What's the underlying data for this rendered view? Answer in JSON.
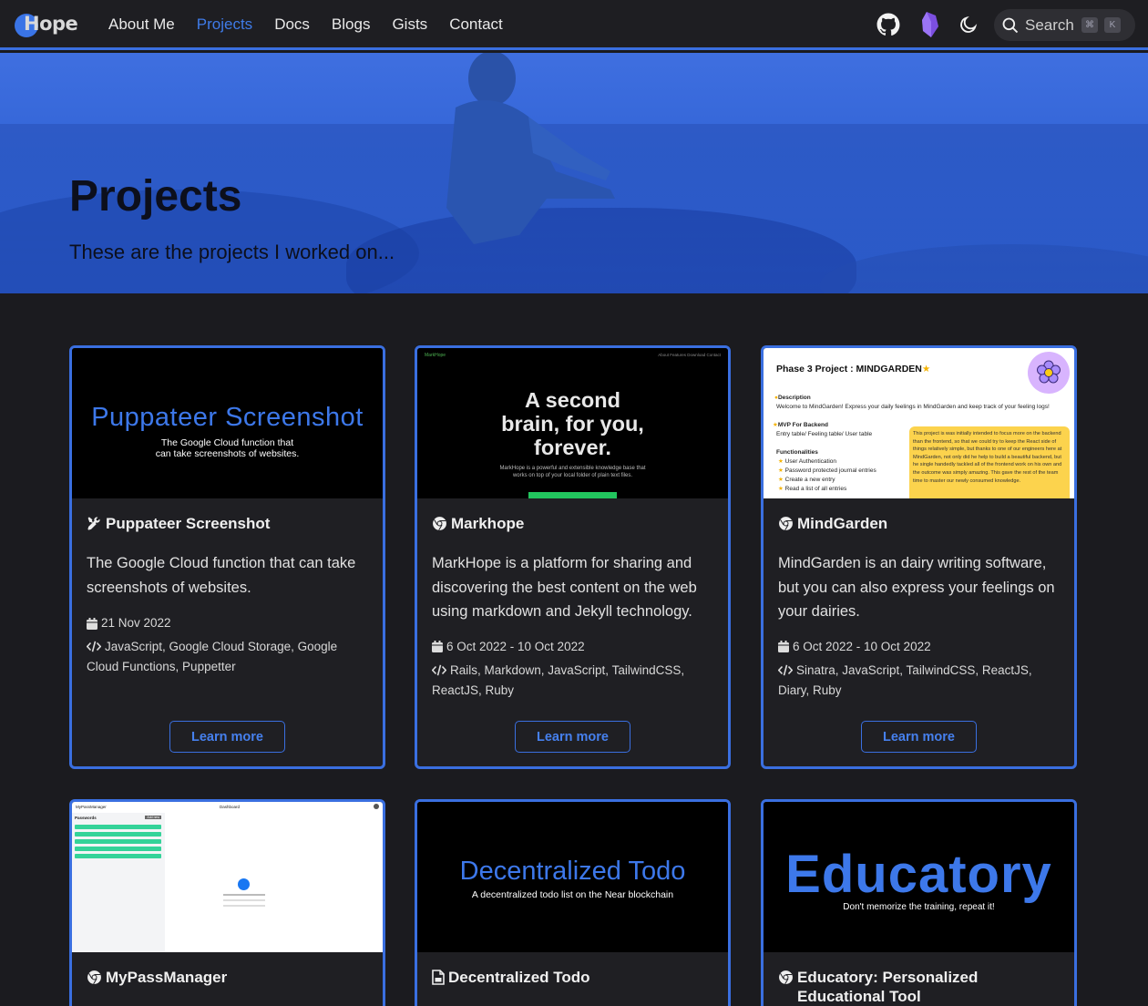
{
  "brand": {
    "name": "Hope"
  },
  "nav": {
    "items": [
      "About Me",
      "Projects",
      "Docs",
      "Blogs",
      "Gists",
      "Contact"
    ],
    "active": "Projects"
  },
  "toolbar": {
    "github_icon": "github-icon",
    "obsidian_icon": "obsidian-icon",
    "theme_icon": "moon-icon"
  },
  "search": {
    "placeholder": "Search",
    "key1": "⌘",
    "key2": "K"
  },
  "hero": {
    "title": "Projects",
    "subtitle": "These are the projects I worked on..."
  },
  "cards": [
    {
      "icon": "tools-icon",
      "title": "Puppateer Screenshot",
      "description": "The Google Cloud function that can take screenshots of websites.",
      "date": "21 Nov 2022",
      "tags": "JavaScript, Google Cloud Storage, Google Cloud Functions, Puppetter",
      "button": "Learn more",
      "image": {
        "title": "Puppateer Screenshot",
        "subtitle_line1": "The Google Cloud function that",
        "subtitle_line2": "can take screenshots of websites."
      }
    },
    {
      "icon": "chrome-icon",
      "title": "Markhope",
      "description": "MarkHope is a platform for sharing and discovering the best content on the web using markdown and Jekyll technology.",
      "date": "6 Oct 2022 - 10 Oct 2022",
      "tags": "Rails, Markdown, JavaScript, TailwindCSS, ReactJS, Ruby",
      "button": "Learn more",
      "image": {
        "nav_left": "MarkHope",
        "nav_right": "About    Features    Download    Contact",
        "title_line1": "A second",
        "title_line2": "brain, for you,",
        "title_line3": "forever.",
        "sub_line1": "MarkHope is a powerful and extensible knowledge base that",
        "sub_line2": "works on top of your local folder of plain text files."
      }
    },
    {
      "icon": "chrome-icon",
      "title": "MindGarden",
      "description": "MindGarden is an dairy writing software, but you can also express your feelings on your dairies.",
      "date": "6 Oct 2022 - 10 Oct 2022",
      "tags": "Sinatra, JavaScript, TailwindCSS, ReactJS, Diary, Ruby",
      "button": "Learn more",
      "image": {
        "title": "Phase 3 Project : MINDGARDEN",
        "desc_h": "Description",
        "desc_t": "Welcome to MindGarden! Express your daily feelings in MindGarden and keep track of your feeling logs!",
        "mvp_h": "MVP For Backend",
        "mvp_t": "Entry table/ Feeling table/ User table",
        "func_h": "Functionalities",
        "f1": "User Authentication",
        "f2": "Password protected journal entries",
        "f3": "Create a new entry",
        "f4": "Read a list of all entries",
        "note": "This project is was initially intended to focus more on the backend than the frontend, so that we could try to keep the React side of things relatively simple, but thanks to one of our engineers here at MindGarden, not only did he help to build a beautiful backend, but he single handedly tackled all of the frontend work on his own and the outcome was simply amazing. This gave the rest of the team time to master our newly consumed knowledge."
      }
    },
    {
      "icon": "chrome-icon",
      "title": "MyPassManager",
      "image": {
        "brand": "MyPassManager",
        "header": "Dashboard",
        "side_title": "Passwords",
        "side_btn": "Add new"
      }
    },
    {
      "icon": "file-icon",
      "title": "Decentralized Todo",
      "image": {
        "title": "Decentralized Todo",
        "subtitle": "A decentralized todo list on the Near blockchain"
      }
    },
    {
      "icon": "chrome-icon",
      "title": "Educatory: Personalized Educational Tool",
      "image": {
        "title": "Educatory",
        "subtitle": "Don't memorize the training, repeat it!"
      }
    }
  ],
  "colors": {
    "accent": "#3a6fe0",
    "link": "#3f7be8",
    "background": "#1b1b1f",
    "card": "#1f1f23"
  }
}
